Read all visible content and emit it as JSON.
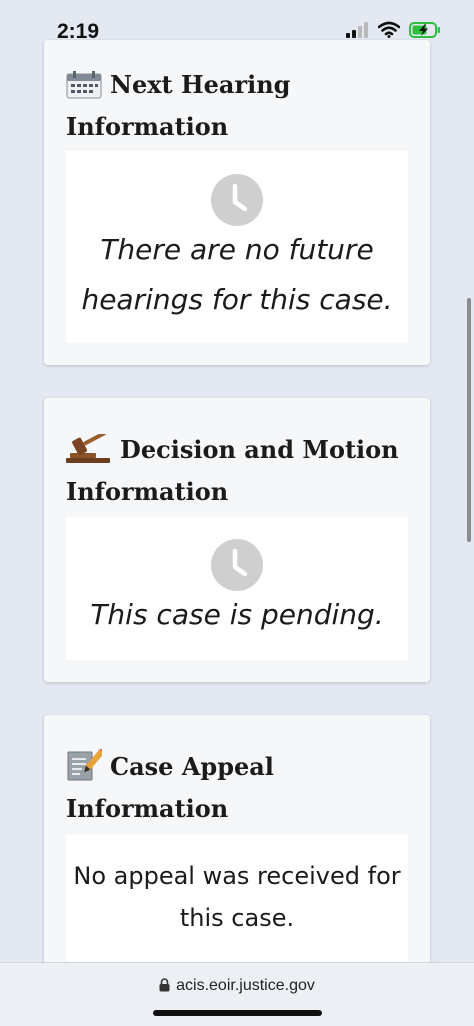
{
  "status_bar": {
    "time": "2:19",
    "battery_charging": true
  },
  "cards": [
    {
      "title": "Next Hearing Information",
      "icon": "calendar-icon",
      "status_icon": "clock-icon",
      "message": "There are no future hearings for this case."
    },
    {
      "title": "Decision and Motion Information",
      "icon": "gavel-icon",
      "status_icon": "clock-icon",
      "message": "This case is pending."
    },
    {
      "title": "Case Appeal Information",
      "icon": "document-pencil-icon",
      "message": "No appeal was received for this case."
    }
  ],
  "browser": {
    "url": "acis.eoir.justice.gov"
  },
  "colors": {
    "background": "#e4e9f1",
    "card": "#f6f7f9",
    "clock": "#cfcfcf",
    "text": "#1b1b1b"
  }
}
